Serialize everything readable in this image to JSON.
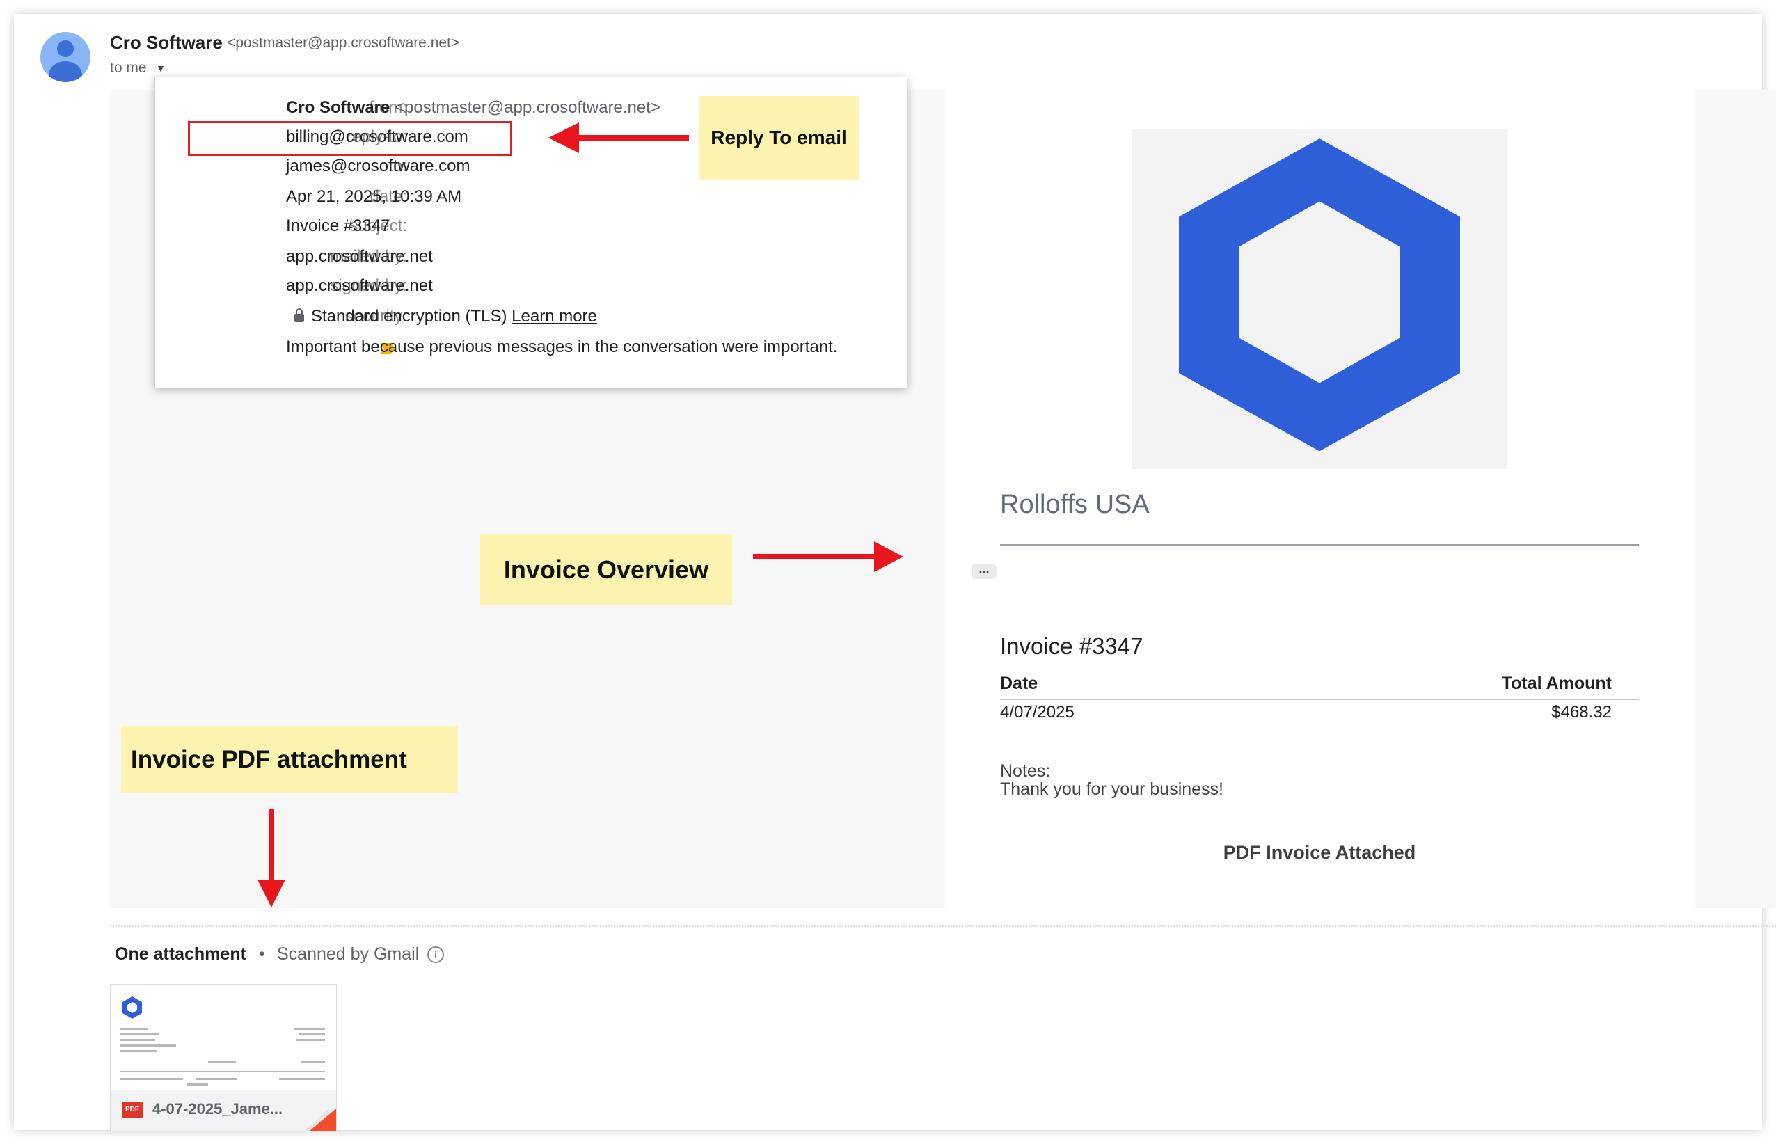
{
  "sender": {
    "name": "Cro Software",
    "email": "<postmaster@app.crosoftware.net>",
    "to_me": "to me"
  },
  "details": {
    "rows": [
      {
        "label": "from:",
        "name": "Cro Software",
        "value": "<postmaster@app.crosoftware.net>"
      },
      {
        "label": "reply-to:",
        "value": "billing@crosoftware.com"
      },
      {
        "label": "to:",
        "value": "james@crosoftware.com"
      },
      {
        "label": "date:",
        "value": "Apr 21, 2025, 10:39 AM"
      },
      {
        "label": "subject:",
        "value": "Invoice #3347"
      },
      {
        "label": "mailed-by:",
        "value": "app.crosoftware.net"
      },
      {
        "label": "signed-by:",
        "value": "app.crosoftware.net"
      },
      {
        "label": "security:",
        "value": "Standard encryption (TLS)",
        "link": "Learn more"
      },
      {
        "label": ":",
        "value": "Important because previous messages in the conversation were important."
      }
    ]
  },
  "annotations": {
    "reply_to": "Reply To email",
    "overview": "Invoice Overview",
    "pdf": "Invoice PDF attachment"
  },
  "invoice": {
    "company": "Rolloffs USA",
    "number": "Invoice #3347",
    "table": {
      "headers": [
        "Date",
        "Total Amount"
      ],
      "row": [
        "4/07/2025",
        "$468.32"
      ]
    },
    "notes_label": "Notes:",
    "notes_text": "Thank you for your business!",
    "pdf_attached": "PDF Invoice Attached"
  },
  "attachments": {
    "title": "One attachment",
    "separator": "•",
    "scanned": "Scanned by Gmail",
    "file_name": "4-07-2025_Jame...",
    "pdf_badge": "PDF"
  },
  "colors": {
    "accent_blue": "#2f5fd8",
    "annotation_red": "#e8161c",
    "annotation_yellow": "#fdf3b0",
    "important_marker": "#f4b400"
  },
  "icons": {
    "lock": "lock-icon",
    "info": "info-icon",
    "important": "important-marker-icon",
    "caret": "chevron-down-icon"
  }
}
